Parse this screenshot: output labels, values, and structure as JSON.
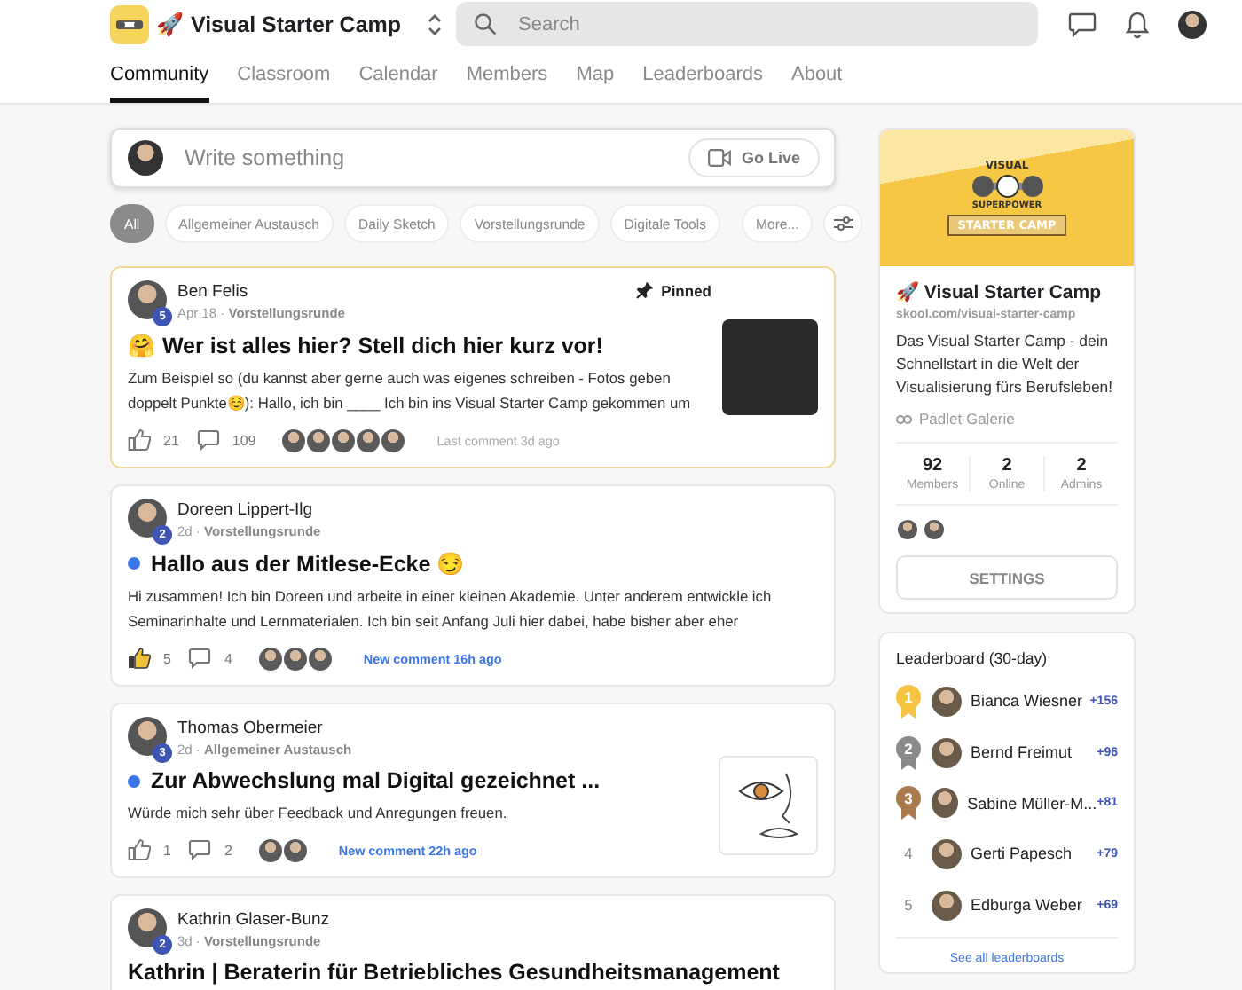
{
  "header": {
    "community_name": "🚀 Visual Starter Camp",
    "search": {
      "placeholder": "Search"
    }
  },
  "tabs": [
    {
      "label": "Community",
      "selected": true
    },
    {
      "label": "Classroom",
      "selected": false
    },
    {
      "label": "Calendar",
      "selected": false
    },
    {
      "label": "Members",
      "selected": false
    },
    {
      "label": "Map",
      "selected": false
    },
    {
      "label": "Leaderboards",
      "selected": false
    },
    {
      "label": "About",
      "selected": false
    }
  ],
  "composer": {
    "placeholder": "Write something",
    "go_live": "Go Live"
  },
  "filters": [
    {
      "label": "All",
      "selected": true
    },
    {
      "label": "Allgemeiner Austausch",
      "selected": false
    },
    {
      "label": "Daily Sketch",
      "selected": false
    },
    {
      "label": "Vorstellungsrunde",
      "selected": false
    },
    {
      "label": "Digitale Tools",
      "selected": false
    },
    {
      "label": "More...",
      "selected": false
    }
  ],
  "posts": [
    {
      "author": "Ben Felis",
      "badge": "5",
      "time": "Apr 18",
      "category": "Vorstellungsrunde",
      "pinned": true,
      "pinned_label": "Pinned",
      "unread": false,
      "title": "🤗 Wer ist alles hier? Stell dich hier kurz vor!",
      "body": "Zum Beispiel so (du kannst aber gerne auch was eigenes schreiben - Fotos geben doppelt Punkte☺️): Hallo, ich bin ____ Ich bin ins Visual Starter Camp gekommen um",
      "likes": "21",
      "liked": false,
      "comments": "109",
      "commenters": [
        {
          "kind": "photo"
        },
        {
          "kind": "photo"
        },
        {
          "kind": "photo"
        },
        {
          "kind": "photo"
        },
        {
          "kind": "photo"
        }
      ],
      "last_comment": "Last comment 3d ago",
      "comment_new": false,
      "thumbnail": {
        "kind": "photo"
      }
    },
    {
      "author": "Doreen Lippert-Ilg",
      "badge": "2",
      "time": "2d",
      "category": "Vorstellungsrunde",
      "pinned": false,
      "unread": true,
      "title": "Hallo aus der Mitlese-Ecke 😏",
      "body": "Hi zusammen! Ich bin Doreen und arbeite in einer kleinen Akademie. Unter anderem entwickle ich Seminarinhalte und Lernmaterialen. Ich bin seit Anfang Juli hier dabei, habe bisher aber eher",
      "likes": "5",
      "liked": true,
      "comments": "4",
      "commenters": [
        {
          "kind": "photo"
        },
        {
          "kind": "photo"
        },
        {
          "kind": "photo"
        }
      ],
      "last_comment": "New comment 16h ago",
      "comment_new": true
    },
    {
      "author": "Thomas Obermeier",
      "badge": "3",
      "time": "2d",
      "category": "Allgemeiner Austausch",
      "pinned": false,
      "unread": true,
      "title": "Zur Abwechslung mal Digital gezeichnet ...",
      "body": "Würde mich sehr über Feedback und Anregungen freuen.",
      "likes": "1",
      "liked": false,
      "comments": "2",
      "commenters": [
        {
          "kind": "photo"
        },
        {
          "kind": "photo"
        }
      ],
      "last_comment": "New comment 22h ago",
      "comment_new": true,
      "thumbnail": {
        "kind": "drawing"
      }
    },
    {
      "author": "Kathrin Glaser-Bunz",
      "badge": "2",
      "time": "3d",
      "category": "Vorstellungsrunde",
      "pinned": false,
      "unread": false,
      "title": "Kathrin | Beraterin für Betriebliches Gesundheitsmanagement"
    }
  ],
  "meta_separator": "·",
  "about": {
    "banner": {
      "top": "VISUAL",
      "middle": "SUPERPOWER",
      "ribbon": "STARTER CAMP"
    },
    "name": "🚀 Visual Starter Camp",
    "url": "skool.com/visual-starter-camp",
    "description": "Das Visual Starter Camp - dein Schnellstart in die Welt der Visualisierung fürs Berufsleben!",
    "link": "Padlet Galerie",
    "stats": [
      {
        "value": "92",
        "label": "Members"
      },
      {
        "value": "2",
        "label": "Online"
      },
      {
        "value": "2",
        "label": "Admins"
      }
    ],
    "admins": [
      {
        "kind": "photo"
      },
      {
        "kind": "photo"
      }
    ],
    "settings": "SETTINGS"
  },
  "leaderboard": {
    "title": "Leaderboard (30-day)",
    "entries": [
      {
        "rank": "1",
        "color": "#f5c542",
        "name": "Bianca Wiesner",
        "points": "+156"
      },
      {
        "rank": "2",
        "color": "#8a8a8a",
        "name": "Bernd Freimut",
        "points": "+96"
      },
      {
        "rank": "3",
        "color": "#a87a4c",
        "name": "Sabine Müller-M...",
        "points": "+81"
      },
      {
        "rank": "4",
        "name": "Gerti Papesch",
        "points": "+79"
      },
      {
        "rank": "5",
        "name": "Edburga Weber",
        "points": "+69"
      }
    ],
    "footer": "See all leaderboards"
  }
}
